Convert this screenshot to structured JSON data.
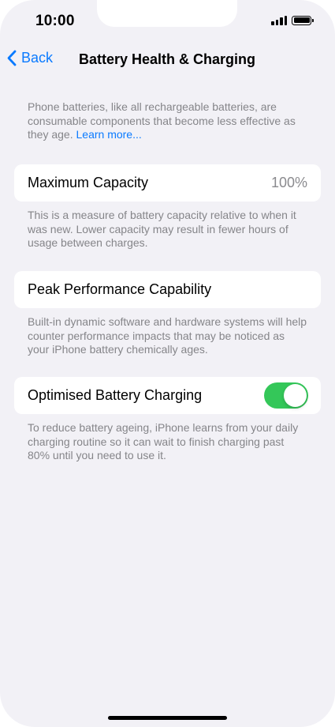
{
  "status_bar": {
    "time": "10:00",
    "icons": [
      "cellular-signal-icon",
      "battery-icon"
    ]
  },
  "nav": {
    "back_label": "Back",
    "title": "Battery Health & Charging"
  },
  "intro": {
    "text": "Phone batteries, like all rechargeable batteries, are consumable components that become less effective as they age. ",
    "link": "Learn more..."
  },
  "maximum_capacity": {
    "label": "Maximum Capacity",
    "value": "100%",
    "footer": "This is a measure of battery capacity relative to when it was new. Lower capacity may result in fewer hours of usage between charges."
  },
  "peak_performance": {
    "label": "Peak Performance Capability",
    "footer": "Built-in dynamic software and hardware systems will help counter performance impacts that may be noticed as your iPhone battery chemically ages."
  },
  "optimised_charging": {
    "label": "Optimised Battery Charging",
    "enabled": true,
    "footer": "To reduce battery ageing, iPhone learns from your daily charging routine so it can wait to finish charging past 80% until you need to use it."
  },
  "colors": {
    "accent": "#0a7aff",
    "toggle_on": "#34c759",
    "background": "#f2f1f6"
  }
}
